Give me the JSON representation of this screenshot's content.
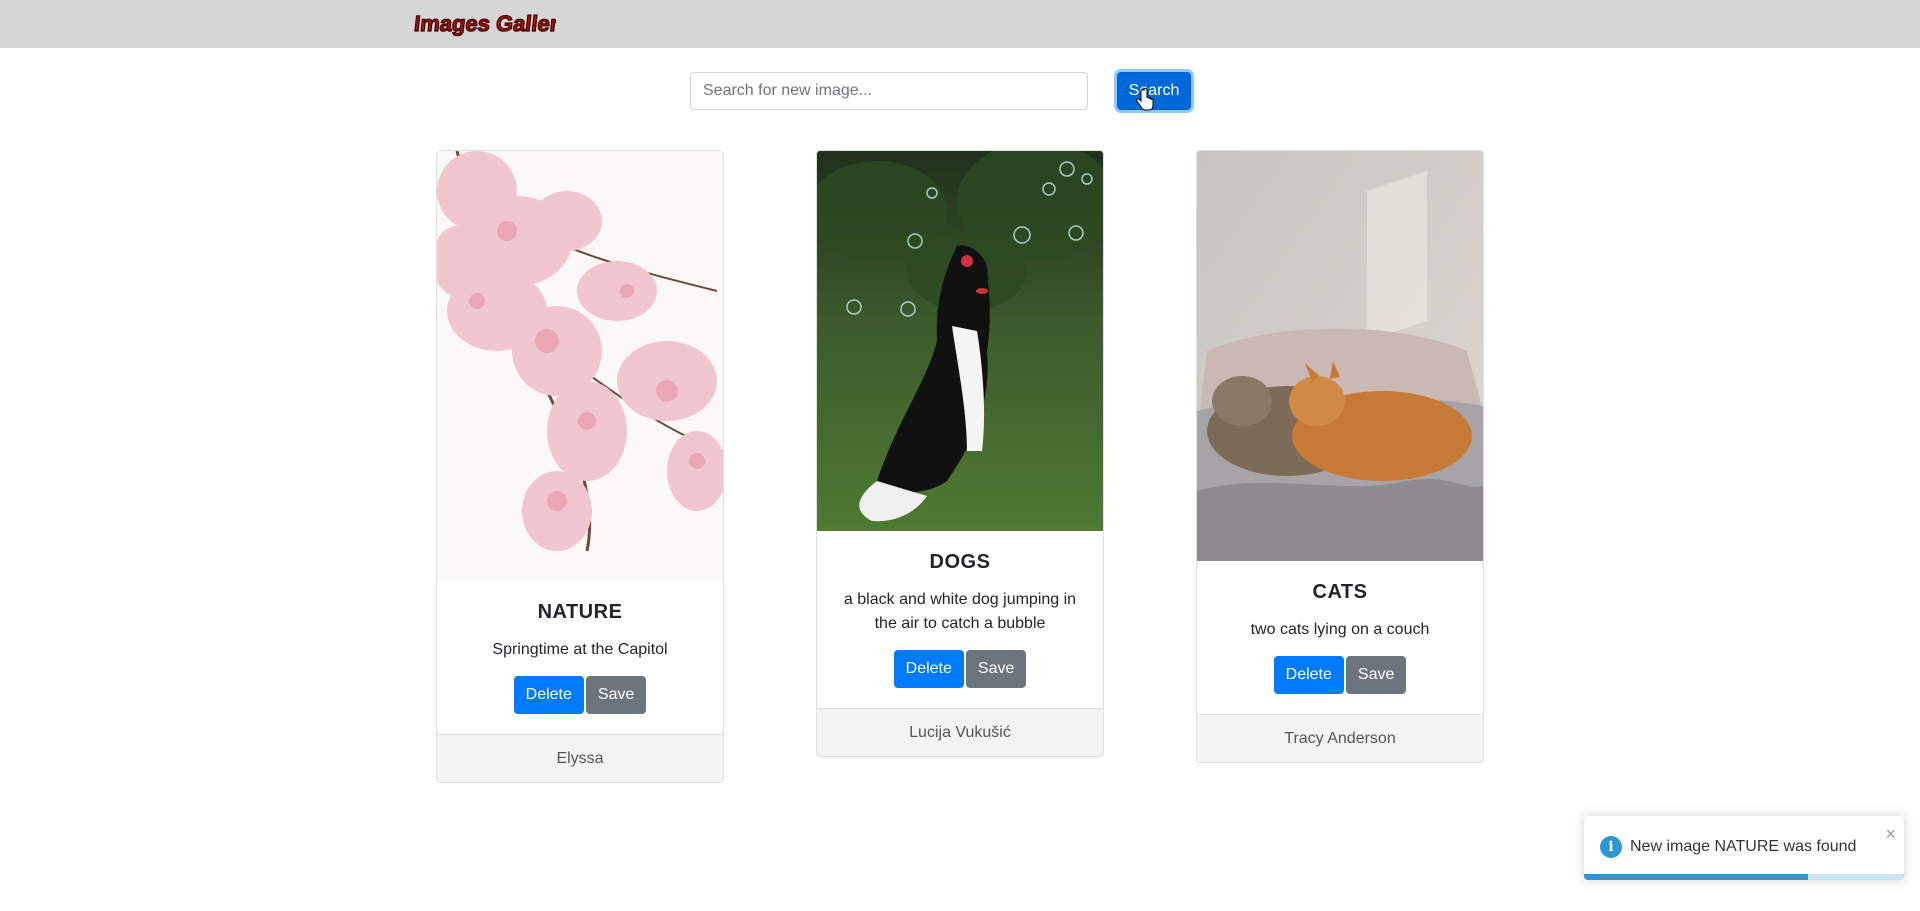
{
  "header": {
    "logo_text": "Images Gallery"
  },
  "search": {
    "placeholder": "Search for new image...",
    "value": "",
    "button_label": "Search"
  },
  "cards": [
    {
      "title": "NATURE",
      "description": "Springtime at the Capitol",
      "author": "Elyssa",
      "delete_label": "Delete",
      "save_label": "Save"
    },
    {
      "title": "DOGS",
      "description": "a black and white dog jumping in the air to catch a bubble",
      "author": "Lucija Vukušić",
      "delete_label": "Delete",
      "save_label": "Save"
    },
    {
      "title": "CATS",
      "description": "two cats lying on a couch",
      "author": "Tracy Anderson",
      "delete_label": "Delete",
      "save_label": "Save"
    }
  ],
  "toast": {
    "message": "New image NATURE was found",
    "close_symbol": "×",
    "progress": 0.7,
    "icon": "info-icon"
  },
  "colors": {
    "primary": "#007bff",
    "secondary": "#6c757d",
    "navbar": "#d6d6d6",
    "toast_info": "#2f96d4"
  }
}
